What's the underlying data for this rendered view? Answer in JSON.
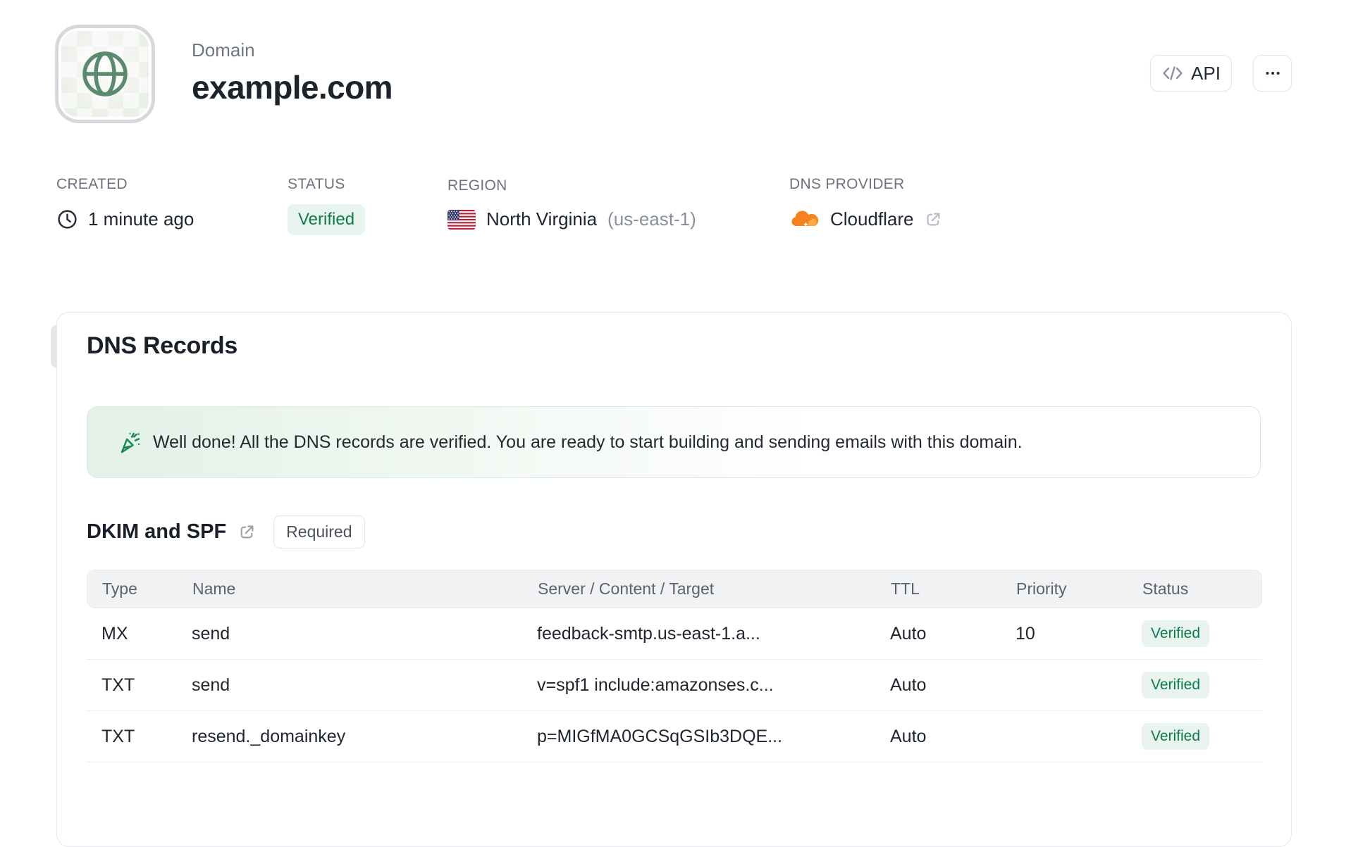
{
  "header": {
    "eyebrow": "Domain",
    "title": "example.com",
    "api_button": {
      "label": "API",
      "icon": "code-icon"
    },
    "more_button": {
      "icon": "ellipsis-icon"
    }
  },
  "meta": {
    "created": {
      "label": "CREATED",
      "icon": "clock-icon",
      "value": "1 minute ago"
    },
    "status": {
      "label": "STATUS",
      "badge": "Verified"
    },
    "region": {
      "label": "REGION",
      "icon": "us-flag-icon",
      "name": "North Virginia",
      "code": "(us-east-1)"
    },
    "dns_provider": {
      "label": "DNS PROVIDER",
      "icon": "cloudflare-icon",
      "value": "Cloudflare"
    }
  },
  "dns_card": {
    "title": "DNS Records",
    "banner": {
      "icon": "party-popper-icon",
      "message": "Well done! All the DNS records are verified. You are ready to start building and sending emails with this domain."
    },
    "section": {
      "title": "DKIM and SPF",
      "badge": "Required"
    },
    "table": {
      "columns": [
        "Type",
        "Name",
        "Server / Content / Target",
        "TTL",
        "Priority",
        "Status"
      ],
      "rows": [
        {
          "type": "MX",
          "name": "send",
          "content": "feedback-smtp.us-east-1.a...",
          "ttl": "Auto",
          "priority": "10",
          "status": "Verified"
        },
        {
          "type": "TXT",
          "name": "send",
          "content": "v=spf1 include:amazonses.c...",
          "ttl": "Auto",
          "priority": "",
          "status": "Verified"
        },
        {
          "type": "TXT",
          "name": "resend._domainkey",
          "content": "p=MIGfMA0GCSqGSIb3DQE...",
          "ttl": "Auto",
          "priority": "",
          "status": "Verified"
        }
      ]
    }
  },
  "colors": {
    "accent_green_text": "#0d7a50",
    "accent_green_bg": "#e9f4ee",
    "banner_green": "#e3f1e7",
    "globe_green": "#5c8a6e",
    "cloudflare_orange": "#f6821f",
    "border": "#e7e8eb",
    "text_dark": "#1d232c",
    "text_gray": "#6d737d"
  }
}
